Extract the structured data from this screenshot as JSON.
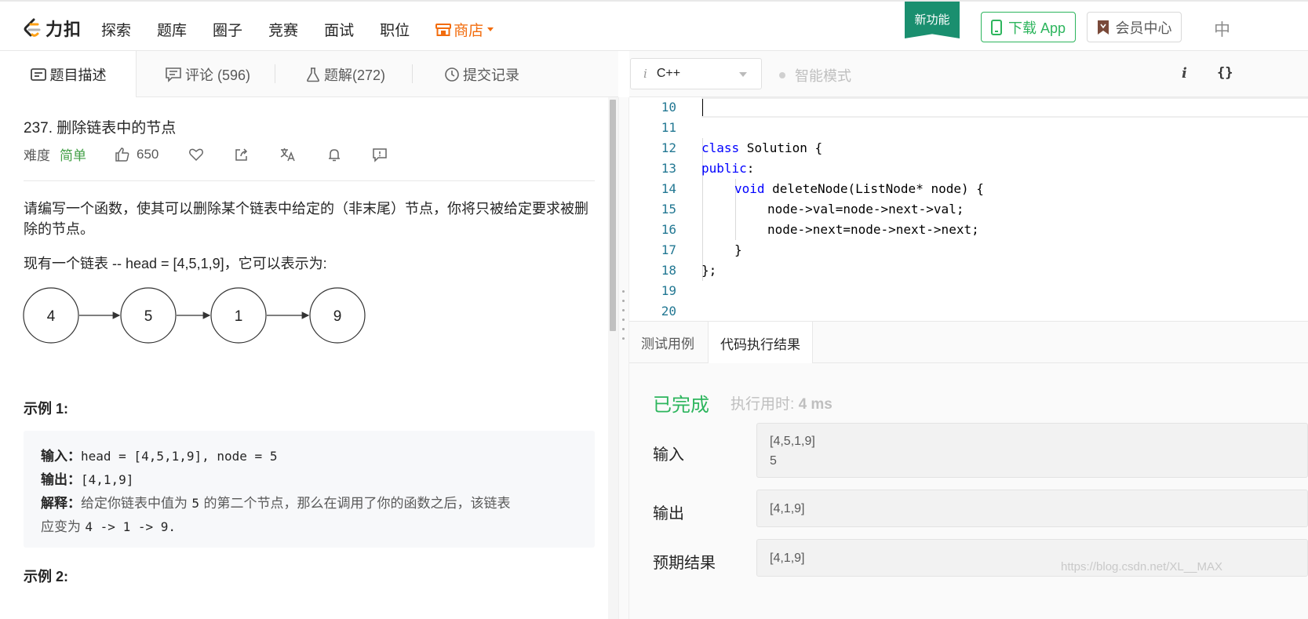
{
  "nav": {
    "logo_text": "力扣",
    "links": [
      "探索",
      "题库",
      "圈子",
      "竞赛",
      "面试",
      "职位"
    ],
    "store": "商店",
    "new_feature_badge": "新功能",
    "download_label": "下载 App",
    "vip_label": "会员中心",
    "lang_label": "中"
  },
  "left_tabs": {
    "description": "题目描述",
    "comments": "评论 (596)",
    "solutions": "题解(272)",
    "submissions": "提交记录"
  },
  "problem": {
    "title": "237. 删除链表中的节点",
    "difficulty_label": "难度",
    "difficulty": "简单",
    "likes": "650",
    "statement": "请编写一个函数，使其可以删除某个链表中给定的（非末尾）节点，你将只被给定要求被删除的节点。",
    "list_intro": "现有一个链表 -- head = [4,5,1,9]，它可以表示为:",
    "nodes": [
      "4",
      "5",
      "1",
      "9"
    ],
    "example1_title": "示例 1:",
    "example1": {
      "input_label": "输入：",
      "input": "head = [4,5,1,9], node = 5",
      "output_label": "输出：",
      "output": "[4,1,9]",
      "explain_label": "解释：",
      "explain_a": "给定你链表中值为 ",
      "explain_val": "5",
      "explain_b": " 的第二个节点，那么在调用了你的函数之后，该链表",
      "explain_c": "应变为 ",
      "explain_result": "4 -> 1 -> 9."
    },
    "example2_title": "示例 2:"
  },
  "editor": {
    "language": "C++",
    "mode": "智能模式",
    "line_numbers": [
      "10",
      "11",
      "12",
      "13",
      "14",
      "15",
      "16",
      "17",
      "18",
      "19",
      "20"
    ],
    "code": {
      "l12a": "class",
      "l12b": " Solution {",
      "l13a": "public",
      "l13b": ":",
      "l14a": "void",
      "l14b": " deleteNode(ListNode* node) {",
      "l15": "node->val=node->next->val;",
      "l16": "node->next=node->next->next;",
      "l17": "}",
      "l18": "};"
    }
  },
  "result_tabs": {
    "testcase": "测试用例",
    "result": "代码执行结果"
  },
  "result": {
    "status": "已完成",
    "time_label": "执行用时:",
    "time_value": "4 ms",
    "input_label": "输入",
    "input_line1": "[4,5,1,9]",
    "input_line2": "5",
    "output_label": "输出",
    "output_value": "[4,1,9]",
    "expected_label": "预期结果",
    "expected_value": "[4,1,9]"
  },
  "watermark": "https://blog.csdn.net/XL__MAX",
  "colors": {
    "accent_green": "#2db55d",
    "store_orange": "#f26c0d",
    "badge_green": "#1a8f6f",
    "keyword_blue": "#0000ff",
    "line_number": "#237893"
  }
}
